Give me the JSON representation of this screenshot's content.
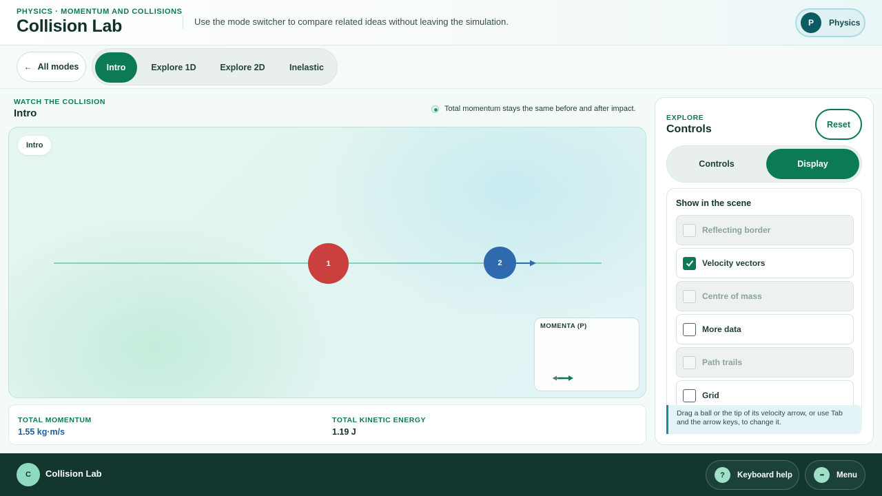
{
  "header": {
    "eyebrow": "PHYSICS · MOMENTUM AND COLLISIONS",
    "title": "Collision Lab",
    "description": "Use the mode switcher to compare related ideas without leaving the simulation.",
    "subject": {
      "initial": "P",
      "label": "Physics"
    }
  },
  "modebar": {
    "back_label": "All modes",
    "tabs": [
      {
        "label": "Intro",
        "active": true
      },
      {
        "label": "Explore 1D",
        "active": false
      },
      {
        "label": "Explore 2D",
        "active": false
      },
      {
        "label": "Inelastic",
        "active": false
      }
    ]
  },
  "stage": {
    "eyebrow": "WATCH THE COLLISION",
    "title": "Intro",
    "hint": "Total momentum stays the same before and after impact.",
    "scene_chip": "Intro",
    "balls": [
      {
        "label": "1",
        "color": "#c9403f"
      },
      {
        "label": "2",
        "color": "#2f69ae"
      }
    ],
    "momenta_title": "MOMENTA (P)"
  },
  "stats": {
    "momentum_label": "TOTAL MOMENTUM",
    "momentum_value": "1.55 kg·m/s",
    "energy_label": "TOTAL KINETIC ENERGY",
    "energy_value": "1.19 J"
  },
  "panel": {
    "eyebrow": "EXPLORE",
    "title": "Controls",
    "reset_label": "Reset",
    "tabs": [
      {
        "label": "Controls",
        "active": false
      },
      {
        "label": "Display",
        "active": true
      }
    ],
    "options_title": "Show in the scene",
    "options": [
      {
        "label": "Reflecting border",
        "checked": false,
        "disabled": true
      },
      {
        "label": "Velocity vectors",
        "checked": true,
        "disabled": false
      },
      {
        "label": "Centre of mass",
        "checked": false,
        "disabled": true
      },
      {
        "label": "More data",
        "checked": false,
        "disabled": false
      },
      {
        "label": "Path trails",
        "checked": false,
        "disabled": true
      },
      {
        "label": "Grid",
        "checked": false,
        "disabled": false
      }
    ],
    "help_text": "Drag a ball or the tip of its velocity arrow, or use Tab and the arrow keys, to change it."
  },
  "footer": {
    "avatar_initial": "C",
    "app_name": "Collision Lab",
    "keyboard_help_icon": "?",
    "keyboard_help_label": "Keyboard help",
    "menu_icon": "•••",
    "menu_label": "Menu"
  },
  "colors": {
    "accent": "#0c7a55",
    "dark": "#13362f",
    "momentum_value": "#1f5fa0"
  }
}
